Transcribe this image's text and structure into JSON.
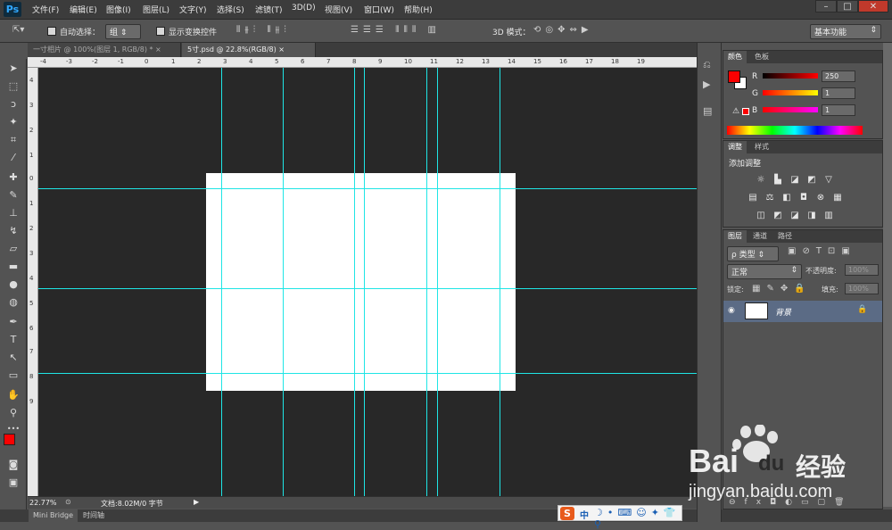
{
  "app": {
    "logo": "Ps"
  },
  "menu": [
    "文件(F)",
    "编辑(E)",
    "图像(I)",
    "图层(L)",
    "文字(Y)",
    "选择(S)",
    "滤镜(T)",
    "3D(D)",
    "视图(V)",
    "窗口(W)",
    "帮助(H)"
  ],
  "window_controls": {
    "minimize": "–",
    "restore": "□",
    "close": "✕"
  },
  "options_bar": {
    "auto_select_label": "自动选择：",
    "auto_select_value": "组",
    "show_transform_label": "显示变换控件",
    "mode_3d_label": "3D 模式：",
    "workspace": "基本功能"
  },
  "doc_tabs": [
    {
      "label": "一寸相片 @ 100%(图层 1, RGB/8) *",
      "close": "×"
    },
    {
      "label": "5寸.psd @ 22.8%(RGB/8)",
      "close": "×"
    }
  ],
  "ruler_top_labels": [
    "-4",
    "-3",
    "-2",
    "-1",
    "0",
    "1",
    "2",
    "3",
    "4",
    "5",
    "6",
    "7",
    "8",
    "9",
    "10",
    "11",
    "12",
    "13",
    "14",
    "15",
    "16",
    "17",
    "18",
    "19"
  ],
  "ruler_left_labels": [
    "4",
    "3",
    "2",
    "1",
    "0",
    "1",
    "2",
    "3",
    "4",
    "5",
    "6",
    "7",
    "8",
    "9"
  ],
  "status": {
    "zoom": "22.77%",
    "doc_info": "文档:8.02M/0 字节"
  },
  "bottom_tabs": [
    "Mini Bridge",
    "时间轴"
  ],
  "color_panel": {
    "tabs": [
      "颜色",
      "色板"
    ],
    "channels": [
      {
        "name": "R",
        "value": "250"
      },
      {
        "name": "G",
        "value": "1"
      },
      {
        "name": "B",
        "value": "1"
      }
    ],
    "foreground": "#fa0101",
    "background": "#ffffff"
  },
  "adjust_panel": {
    "tabs": [
      "调整",
      "样式"
    ],
    "title": "添加调整"
  },
  "layers_panel": {
    "tabs": [
      "图层",
      "通道",
      "路径"
    ],
    "filter_label": "ρ 类型",
    "blend_mode": "正常",
    "opacity_label": "不透明度:",
    "opacity_value": "100%",
    "lock_label": "锁定:",
    "fill_label": "填充:",
    "fill_value": "100%",
    "layer_name": "背景"
  },
  "watermark": {
    "brand": "Bai",
    "paw": "du",
    "cn": "经验",
    "url": "jingyan.baidu.com"
  },
  "tray": {
    "sogou": "S",
    "lang": "中"
  }
}
